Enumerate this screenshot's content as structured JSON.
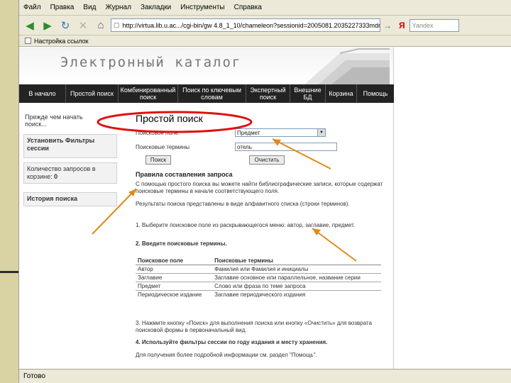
{
  "menu": [
    "Файл",
    "Правка",
    "Вид",
    "Журнал",
    "Закладки",
    "Инструменты",
    "Справка"
  ],
  "toolbar": {
    "address": "http://virtua.lib.u.ac.../cgi-bin/gw 4.8_1_10/chameleon?sessionid=2005081.2035227333mdn-def",
    "go_arrow": "→",
    "yandex_letter": "Я",
    "yandex_placeholder": "Yandex"
  },
  "links_bar": {
    "label": "Настройка ссылок"
  },
  "catalog": {
    "title": "Электронный каталог",
    "nav": [
      "В начало",
      "Простой поиск",
      "Комбинированный поиск",
      "Поиск по ключевым словам",
      "Экспертный поиск",
      "Внешние БД",
      "Корзина",
      "Помощь"
    ]
  },
  "sidebar": {
    "before_start": "Прежде чем начать поиск...",
    "set_filters": "Установить Фильтры сессии",
    "query_count_label": "Количество запросов в корзине:",
    "query_count_value": "0",
    "search_history": "История поиска"
  },
  "search_form": {
    "title": "Простой поиск",
    "field_label": "Поисковое поле:",
    "field_value": "Предмет",
    "terms_label": "Поисковые термины",
    "terms_value": "отель",
    "search_button": "Поиск",
    "clear_button": "Очистить"
  },
  "rules": {
    "title": "Правила составления запроса",
    "intro": "С помощью простого поиска вы можете найти библиографические записи, которые содержат поисковые термины в начале соответствующего поля.",
    "result_note": "Результаты поиска представлены в виде алфавитного списка (строки терминов).",
    "step1": "1. Выберите поисковое поле из раскрывающегося меню: автор, заглавие, предмет.",
    "step2": "2. Введите поисковые термины.",
    "table_headers": [
      "Поисковое поле",
      "Поисковые термины"
    ],
    "table_rows": [
      [
        "Автор",
        "Фамилия или Фамилия и инициалы"
      ],
      [
        "Заглавие",
        "Заглавие основное или параллельное, название серии"
      ],
      [
        "Предмет",
        "Слово или фраза по теме запроса"
      ],
      [
        "Периодическое издание",
        "Заглавие периодического издания"
      ]
    ],
    "step3": "3. Нажмите кнопку «Поиск» для выполнения поиска или кнопку «Очистить» для возврата поисковой формы в первоначальный вид.",
    "step4": "4. Используйте фильтры сессии по году издания и месту хранения.",
    "more_info": "Для получения более подробной информации см. раздел \"Помощь\"."
  },
  "status": {
    "text": "Готово"
  },
  "colors": {
    "annotation_ellipse": "#e01010",
    "annotation_arrow": "#e08a1a",
    "navbar": "#232323",
    "slide_stripe": "#d9d3a4"
  }
}
